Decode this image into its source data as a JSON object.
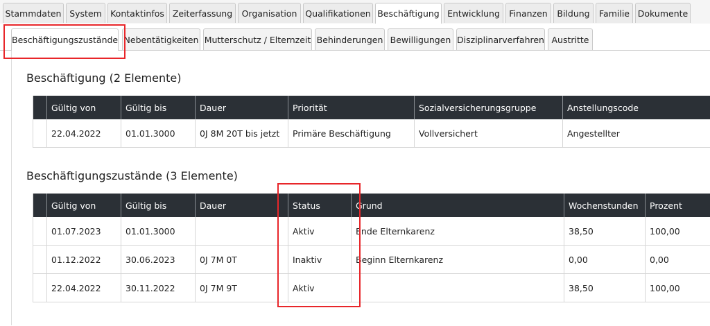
{
  "main_tabs": [
    "Stammdaten",
    "System",
    "Kontaktinfos",
    "Zeiterfassung",
    "Organisation",
    "Qualifikationen",
    "Beschäftigung",
    "Entwicklung",
    "Finanzen",
    "Bildung",
    "Familie",
    "Dokumente"
  ],
  "main_tab_active": "Beschäftigung",
  "sub_tabs": [
    "Beschäftigungszustände",
    "Nebentätigkeiten",
    "Mutterschutz / Elternzeit",
    "Behinderungen",
    "Bewilligungen",
    "Disziplinarverfahren",
    "Austritte"
  ],
  "sub_tab_active": "Beschäftigungszustände",
  "employment": {
    "title": "Beschäftigung (2 Elemente)",
    "columns": [
      "Gültig von",
      "Gültig bis",
      "Dauer",
      "Priorität",
      "Sozialversicherungsgruppe",
      "Anstellungscode"
    ],
    "rows": [
      [
        "22.04.2022",
        "01.01.3000",
        "0J 8M 20T bis jetzt",
        "Primäre Beschäftigung",
        "Vollversichert",
        "Angestellter"
      ]
    ]
  },
  "states": {
    "title": "Beschäftigungszustände (3 Elemente)",
    "columns": [
      "Gültig von",
      "Gültig bis",
      "Dauer",
      "Status",
      "Grund",
      "Wochenstunden",
      "Prozent"
    ],
    "rows": [
      [
        "01.07.2023",
        "01.01.3000",
        "",
        "Aktiv",
        "Ende Elternkarenz",
        "38,50",
        "100,00"
      ],
      [
        "01.12.2022",
        "30.06.2023",
        "0J 7M 0T",
        "Inaktiv",
        "Beginn Elternkarenz",
        "0,00",
        "0,00"
      ],
      [
        "22.04.2022",
        "30.11.2022",
        "0J 7M 9T",
        "Aktiv",
        "",
        "38,50",
        "100,00"
      ]
    ]
  },
  "colors": {
    "header_bg": "#2b3036",
    "highlight": "#e8262a"
  }
}
